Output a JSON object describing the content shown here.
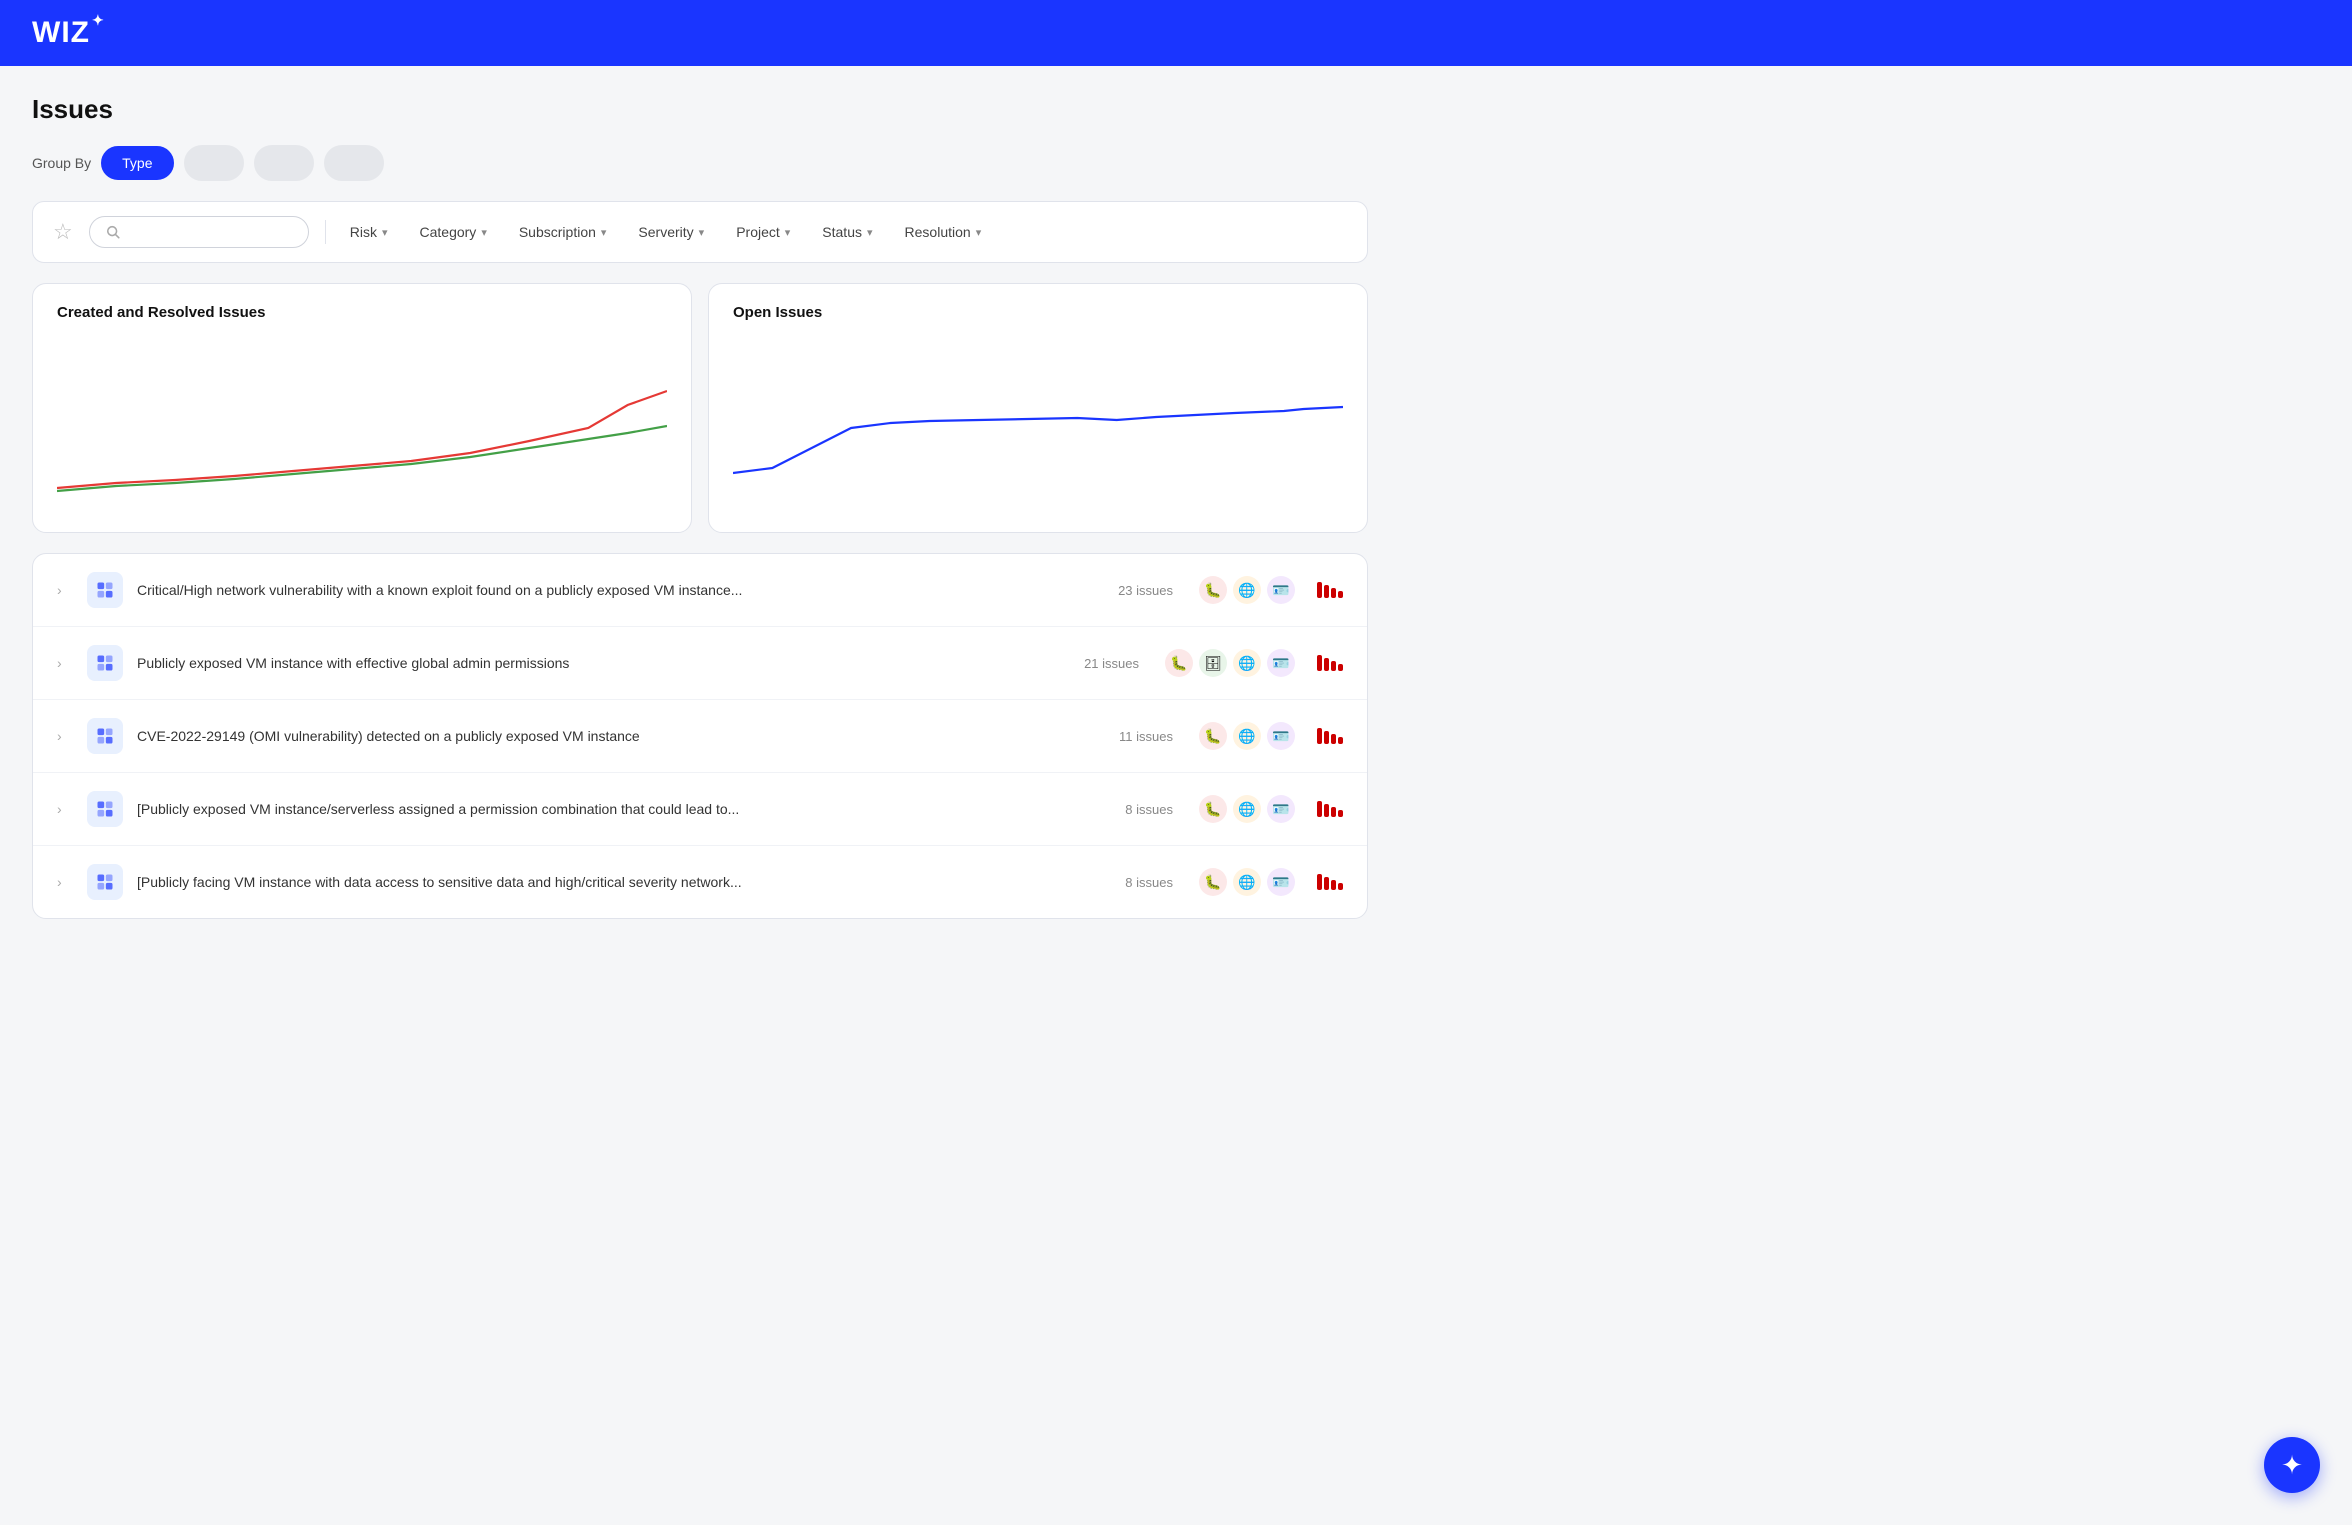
{
  "header": {
    "logo_text": "wiz",
    "logo_star": "✦"
  },
  "page": {
    "title": "Issues"
  },
  "group_by": {
    "label": "Group By",
    "options": [
      {
        "id": "type",
        "label": "Type",
        "active": true
      },
      {
        "id": "opt2",
        "label": "",
        "active": false
      },
      {
        "id": "opt3",
        "label": "",
        "active": false
      },
      {
        "id": "opt4",
        "label": "",
        "active": false
      }
    ]
  },
  "filters": {
    "star_label": "☆",
    "search_placeholder": "",
    "items": [
      {
        "id": "risk",
        "label": "Risk"
      },
      {
        "id": "category",
        "label": "Category"
      },
      {
        "id": "subscription",
        "label": "Subscription"
      },
      {
        "id": "severity",
        "label": "Serverity"
      },
      {
        "id": "project",
        "label": "Project"
      },
      {
        "id": "status",
        "label": "Status"
      },
      {
        "id": "resolution",
        "label": "Resolution"
      }
    ]
  },
  "charts": {
    "left": {
      "title": "Created and Resolved Issues"
    },
    "right": {
      "title": "Open Issues"
    }
  },
  "issues": [
    {
      "text": "Critical/High network vulnerability with a known exploit found on a publicly exposed VM instance...",
      "count": "23 issues",
      "badges": [
        "bug-red",
        "globe-orange",
        "id-purple"
      ],
      "bars": [
        14,
        12,
        10,
        8
      ]
    },
    {
      "text": "Publicly exposed VM instance with effective global admin permissions",
      "count": "21 issues",
      "badges": [
        "bug-red",
        "db-green",
        "globe-orange",
        "id-purple"
      ],
      "bars": [
        14,
        12,
        10,
        8
      ]
    },
    {
      "text": "CVE-2022-29149 (OMI vulnerability) detected on a publicly exposed VM instance",
      "count": "11 issues",
      "badges": [
        "bug-red",
        "globe-orange",
        "id-purple"
      ],
      "bars": [
        14,
        12,
        10,
        8
      ]
    },
    {
      "text": "[Publicly exposed VM instance/serverless assigned a permission combination that could lead to...",
      "count": "8 issues",
      "badges": [
        "bug-red",
        "globe-orange",
        "id-purple"
      ],
      "bars": [
        14,
        12,
        10,
        8
      ]
    },
    {
      "text": "[Publicly facing VM instance with data access to sensitive data and high/critical severity network...",
      "count": "8 issues",
      "badges": [
        "bug-red",
        "globe-orange",
        "id-purple"
      ],
      "bars": [
        14,
        12,
        10,
        8
      ]
    }
  ],
  "fab": {
    "icon": "✦"
  }
}
